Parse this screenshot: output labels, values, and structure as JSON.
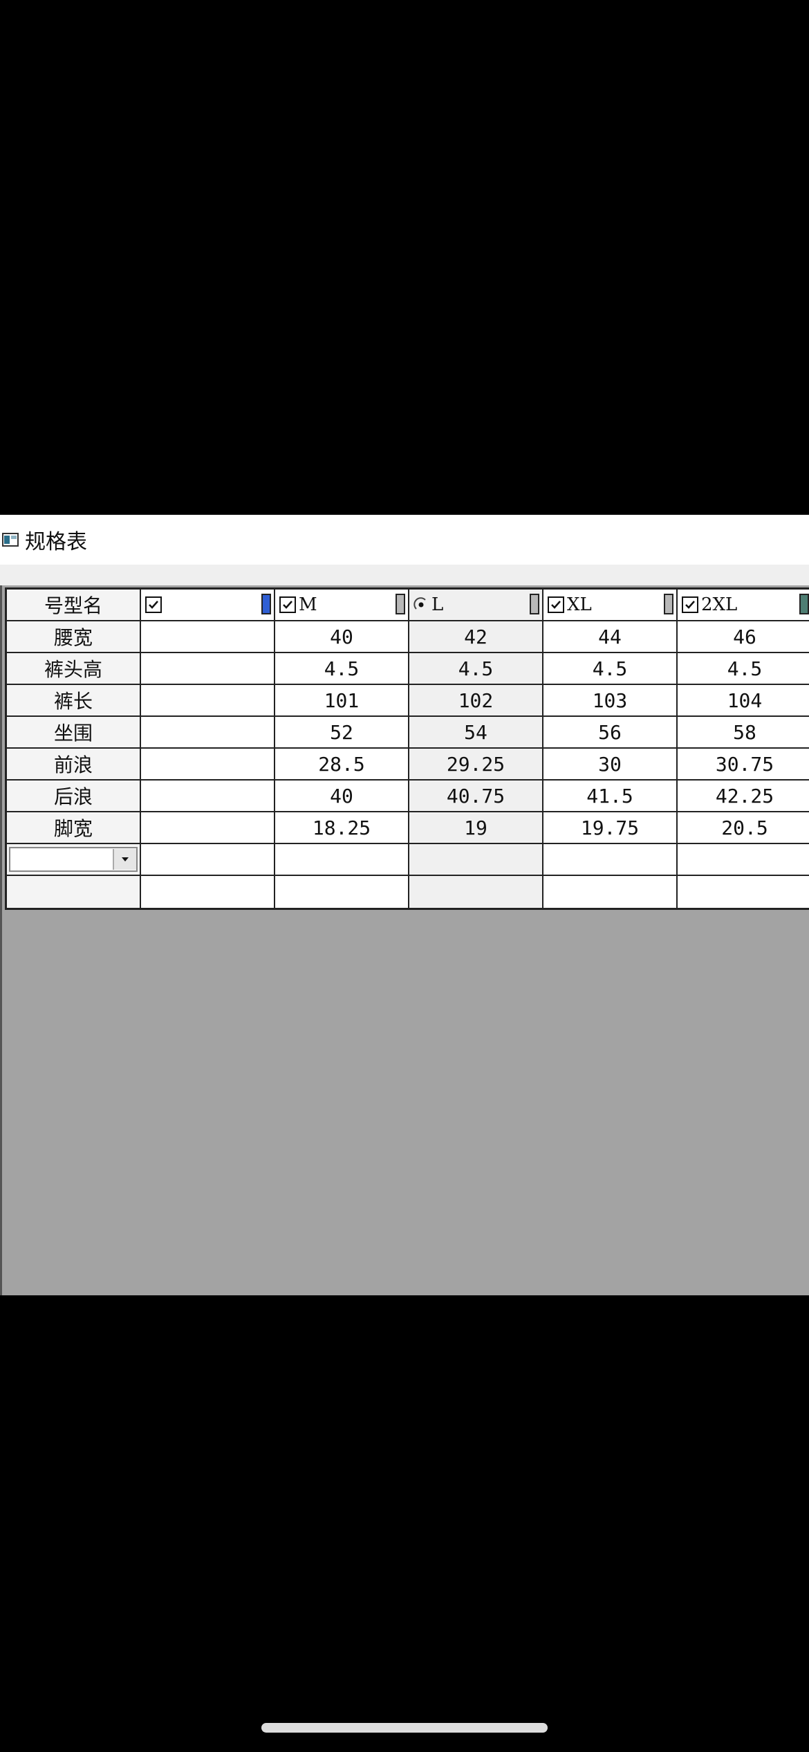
{
  "window": {
    "title": "规格表"
  },
  "grid": {
    "header": {
      "corner_label": "号型名",
      "columns": [
        {
          "label": "",
          "checked": true,
          "control": "checkbox",
          "swatch_color": "#2f5fd4"
        },
        {
          "label": "M",
          "checked": true,
          "control": "checkbox",
          "swatch_color": "#b8b8b8"
        },
        {
          "label": "L",
          "checked": true,
          "control": "radio",
          "swatch_color": "#b8b8b8"
        },
        {
          "label": "XL",
          "checked": true,
          "control": "checkbox",
          "swatch_color": "#b8b8b8"
        },
        {
          "label": "2XL",
          "checked": true,
          "control": "checkbox",
          "swatch_color": "#4e7e73"
        }
      ]
    },
    "rows": [
      {
        "name": "腰宽",
        "values": [
          "",
          "40",
          "42",
          "44",
          "46"
        ]
      },
      {
        "name": "裤头高",
        "values": [
          "",
          "4.5",
          "4.5",
          "4.5",
          "4.5"
        ]
      },
      {
        "name": "裤长",
        "values": [
          "",
          "101",
          "102",
          "103",
          "104"
        ]
      },
      {
        "name": "坐围",
        "values": [
          "",
          "52",
          "54",
          "56",
          "58"
        ]
      },
      {
        "name": "前浪",
        "values": [
          "",
          "28.5",
          "29.25",
          "30",
          "30.75"
        ]
      },
      {
        "name": "后浪",
        "values": [
          "",
          "40",
          "40.75",
          "41.5",
          "42.25"
        ]
      },
      {
        "name": "脚宽",
        "values": [
          "",
          "18.25",
          "19",
          "19.75",
          "20.5"
        ]
      }
    ],
    "empty_rows": 2,
    "combo_value": ""
  },
  "colors": {
    "grid_border": "#222222",
    "workspace_bg": "#a3a3a3",
    "highlight_column_bg": "#f0f0f0"
  }
}
